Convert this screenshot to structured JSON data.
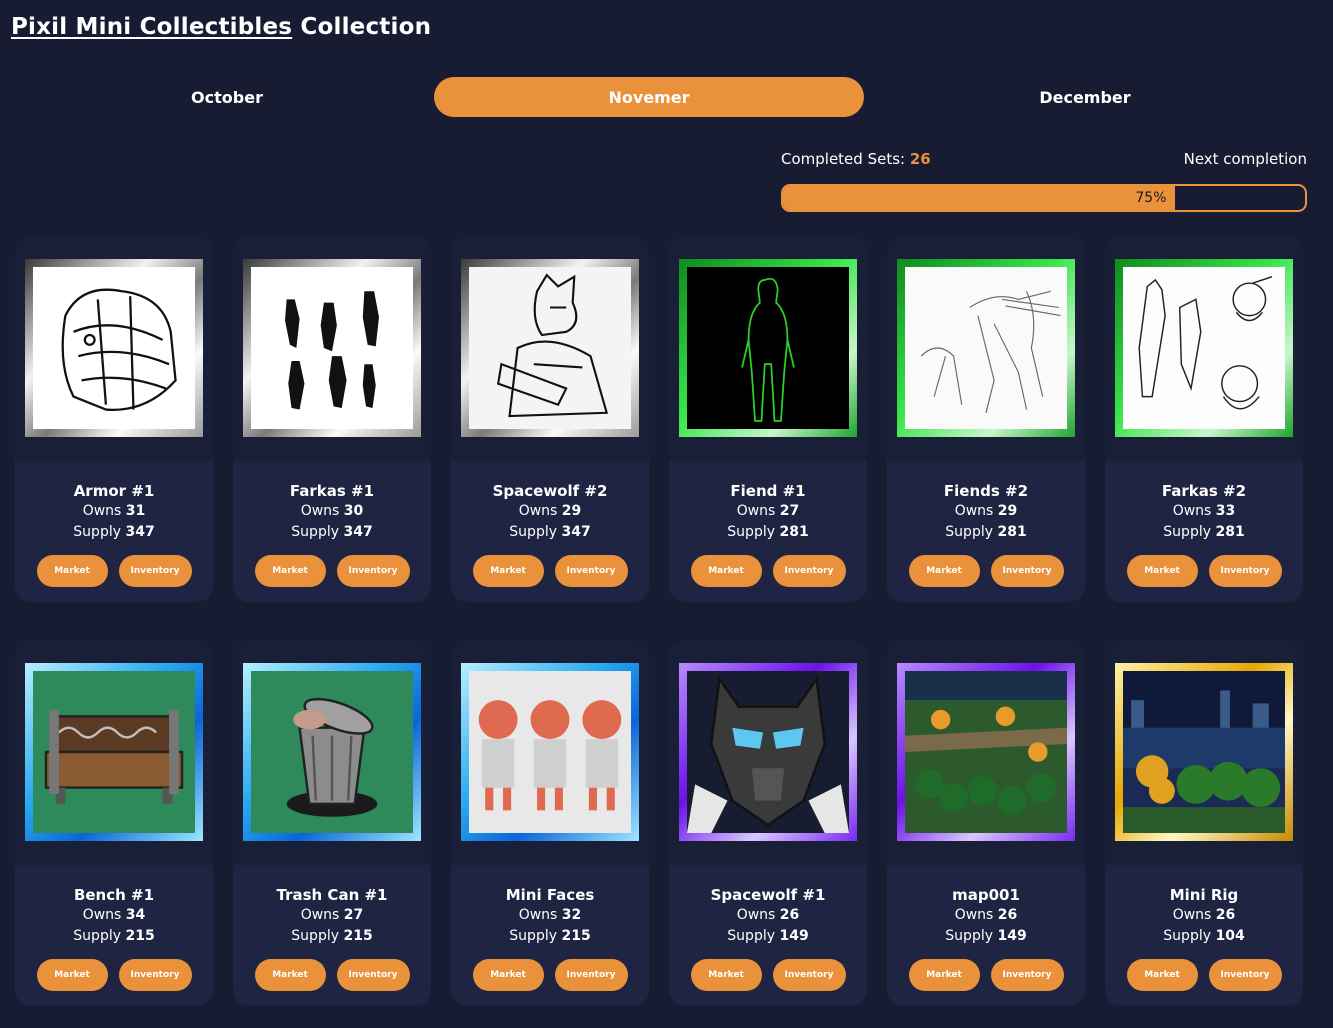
{
  "header": {
    "title_link": "Pixil Mini Collectibles",
    "title_rest": "Collection"
  },
  "tabs": [
    {
      "label": "October",
      "active": false
    },
    {
      "label": "Novemer",
      "active": true
    },
    {
      "label": "December",
      "active": false
    }
  ],
  "stats": {
    "completed_label": "Completed Sets:",
    "completed_value": "26",
    "next_label": "Next completion",
    "progress_percent": 75,
    "progress_text": "75%"
  },
  "labels": {
    "owns": "Owns",
    "supply": "Supply",
    "market": "Market",
    "inventory": "Inventory"
  },
  "colors": {
    "background": "#171c33",
    "card": "#1e2442",
    "accent": "#ea913c"
  },
  "cards": [
    {
      "name": "Armor #1",
      "owns": "31",
      "supply": "347",
      "frame": "silver",
      "art": "armor"
    },
    {
      "name": "Farkas #1",
      "owns": "30",
      "supply": "347",
      "frame": "silver",
      "art": "farkas"
    },
    {
      "name": "Spacewolf #2",
      "owns": "29",
      "supply": "347",
      "frame": "silver",
      "art": "spacewolf-sketch"
    },
    {
      "name": "Fiend #1",
      "owns": "27",
      "supply": "281",
      "frame": "green",
      "art": "fiend"
    },
    {
      "name": "Fiends #2",
      "owns": "29",
      "supply": "281",
      "frame": "green",
      "art": "fiends-sketch"
    },
    {
      "name": "Farkas #2",
      "owns": "33",
      "supply": "281",
      "frame": "green",
      "art": "farkas-sketch"
    },
    {
      "name": "Bench #1",
      "owns": "34",
      "supply": "215",
      "frame": "blue",
      "art": "bench"
    },
    {
      "name": "Trash Can #1",
      "owns": "27",
      "supply": "215",
      "frame": "blue",
      "art": "trash"
    },
    {
      "name": "Mini Faces",
      "owns": "32",
      "supply": "215",
      "frame": "blue",
      "art": "faces"
    },
    {
      "name": "Spacewolf #1",
      "owns": "26",
      "supply": "149",
      "frame": "purple",
      "art": "wolf"
    },
    {
      "name": "map001",
      "owns": "26",
      "supply": "149",
      "frame": "purple",
      "art": "map"
    },
    {
      "name": "Mini Rig",
      "owns": "26",
      "supply": "104",
      "frame": "gold",
      "art": "rig"
    }
  ]
}
